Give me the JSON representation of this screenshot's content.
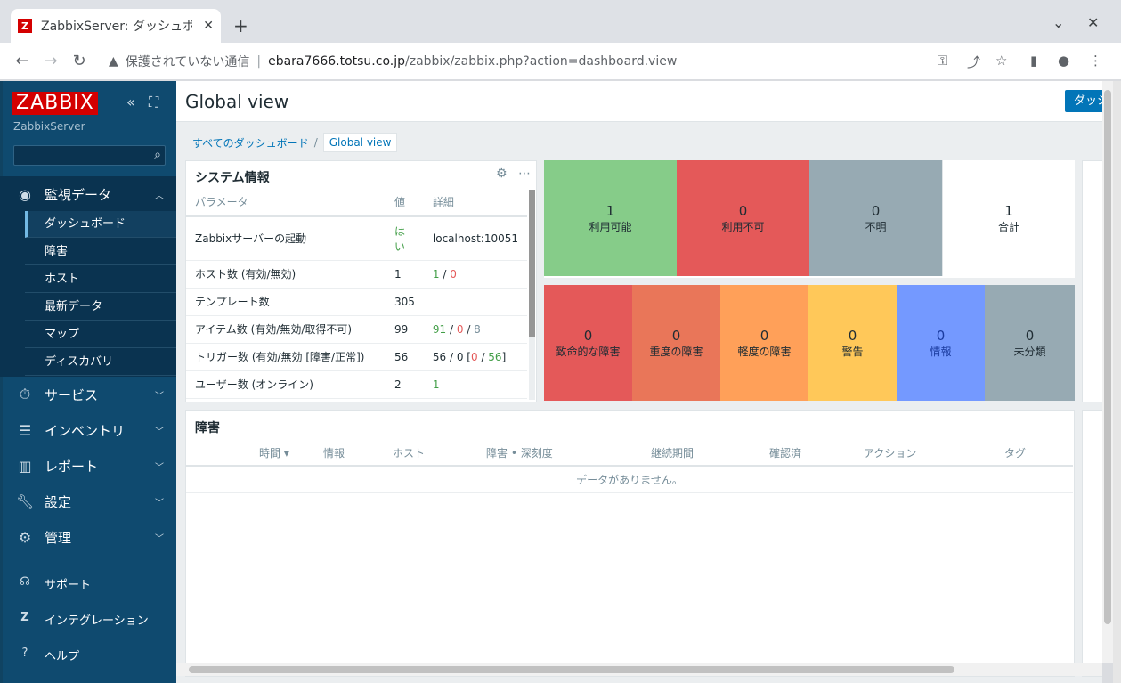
{
  "browser": {
    "tab_title": "ZabbixServer: ダッシュボード",
    "tab_favicon": "Z",
    "address": {
      "warning": "保護されていない通信",
      "host": "ebara7666.totsu.co.jp",
      "path": "/zabbix/zabbix.php?action=dashboard.view"
    }
  },
  "sidebar": {
    "logo": "ZABBIX",
    "server_name": "ZabbixServer",
    "search_placeholder": "",
    "menu": [
      {
        "label": "監視データ",
        "icon": "eye-icon"
      },
      {
        "label": "サービス",
        "icon": "stopwatch-icon"
      },
      {
        "label": "インベントリ",
        "icon": "list-icon"
      },
      {
        "label": "レポート",
        "icon": "bar-chart-icon"
      },
      {
        "label": "設定",
        "icon": "wrench-icon"
      },
      {
        "label": "管理",
        "icon": "gear-icon"
      }
    ],
    "submenu": [
      "ダッシュボード",
      "障害",
      "ホスト",
      "最新データ",
      "マップ",
      "ディスカバリ"
    ],
    "footer": [
      {
        "label": "サポート",
        "icon": "headset-icon"
      },
      {
        "label": "インテグレーション",
        "icon": "zabbix-z-icon"
      },
      {
        "label": "ヘルプ",
        "icon": "question-icon"
      }
    ]
  },
  "header": {
    "title": "Global view",
    "dashboard_button": "ダッシ"
  },
  "breadcrumb": {
    "all": "すべてのダッシュボード",
    "sep": "/",
    "current": "Global view"
  },
  "system_info": {
    "title": "システム情報",
    "columns": [
      "パラメータ",
      "値",
      "詳細"
    ],
    "rows": [
      {
        "param": "Zabbixサーバーの起動",
        "value": "はい",
        "detail": "localhost:10051"
      },
      {
        "param": "ホスト数 (有効/無効)",
        "value": "1",
        "d1": "1",
        "s1": " / ",
        "d2": "0"
      },
      {
        "param": "テンプレート数",
        "value": "305"
      },
      {
        "param": "アイテム数 (有効/無効/取得不可)",
        "value": "99",
        "d1": "91",
        "s1": " / ",
        "d2": "0",
        "s2": " / ",
        "d3": "8"
      },
      {
        "param": "トリガー数 (有効/無効 [障害/正常])",
        "value": "56",
        "pre": "56 / 0 [",
        "d1": "0",
        "s1": " / ",
        "d2": "56",
        "post": "]"
      },
      {
        "param": "ユーザー数 (オンライン)",
        "value": "2",
        "d1": "1"
      }
    ]
  },
  "host_availability": [
    {
      "count": "1",
      "label": "利用可能",
      "color": "#86cc89"
    },
    {
      "count": "0",
      "label": "利用不可",
      "color": "#e45959"
    },
    {
      "count": "0",
      "label": "不明",
      "color": "#97aab3"
    },
    {
      "count": "1",
      "label": "合計",
      "color": "#ffffff"
    }
  ],
  "severity": [
    {
      "count": "0",
      "label": "致命的な障害",
      "color": "#e45959"
    },
    {
      "count": "0",
      "label": "重度の障害",
      "color": "#e97659"
    },
    {
      "count": "0",
      "label": "軽度の障害",
      "color": "#ffa059"
    },
    {
      "count": "0",
      "label": "警告",
      "color": "#ffc859"
    },
    {
      "count": "0",
      "label": "情報",
      "color": "#7499ff"
    },
    {
      "count": "0",
      "label": "未分類",
      "color": "#97aab3"
    }
  ],
  "problems": {
    "title": "障害",
    "columns": [
      "時間 ▾",
      "情報",
      "ホスト",
      "障害 • 深刻度",
      "継続期間",
      "確認済",
      "アクション",
      "タグ"
    ],
    "empty": "データがありません。"
  }
}
